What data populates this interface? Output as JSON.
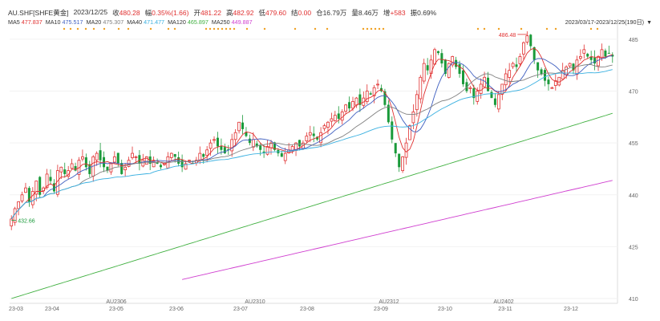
{
  "header": {
    "symbol": "AU.SHF[SHFE黄金]",
    "date": "2023/12/25",
    "close_label": "收",
    "close": "480.28",
    "change_label": "幅",
    "change": "0.35%(1.66)",
    "open_label": "开",
    "open": "481.22",
    "high_label": "高",
    "high": "482.92",
    "low_label": "低",
    "low": "479.60",
    "settle_label": "结",
    "settle": "0.00",
    "oi_label": "仓",
    "oi": "16.79万",
    "vol_label": "量",
    "vol": "8.46万",
    "oichg_label": "增",
    "oichg": "+583",
    "amp_label": "振",
    "amp": "0.69%"
  },
  "ma_legend": [
    {
      "label": "MA5",
      "value": "477.837",
      "color": "#e03030"
    },
    {
      "label": "MA10",
      "value": "475.517",
      "color": "#4060c0"
    },
    {
      "label": "MA20",
      "value": "475.307",
      "color": "#808080"
    },
    {
      "label": "MA40",
      "value": "471.477",
      "color": "#3ab0e0"
    },
    {
      "label": "MA120",
      "value": "465.897",
      "color": "#40b040"
    },
    {
      "label": "MA250",
      "value": "449.887",
      "color": "#d040d0"
    }
  ],
  "date_range": "2023/03/17-2023/12/25(190日)",
  "colors": {
    "up": "#e03030",
    "down": "#1a9a3a",
    "dot": "#f0a020"
  },
  "chart_data": {
    "type": "candlestick",
    "ylim": [
      410,
      488
    ],
    "y_ticks": [
      "485",
      "470",
      "455",
      "440",
      "425",
      "410"
    ],
    "x_ticks": [
      "23-03",
      "23-04",
      "AU2306",
      "23-05",
      "23-06",
      "23-07",
      "AU2310",
      "23-08",
      "23-09",
      "AU2312",
      "23-10",
      "23-11",
      "AU2402",
      "23-12"
    ],
    "max_label": "486.48",
    "min_label": "432.66",
    "close_series": [
      433,
      436,
      438,
      440,
      442,
      438,
      441,
      444,
      440,
      442,
      446,
      444,
      441,
      447,
      448,
      446,
      447,
      449,
      447,
      450,
      451,
      448,
      446,
      451,
      452,
      450,
      448,
      447,
      449,
      451,
      449,
      446,
      448,
      450,
      452,
      451,
      449,
      450,
      451,
      449,
      450,
      449,
      448,
      449,
      451,
      452,
      451,
      449,
      448,
      449,
      450,
      449,
      450,
      452,
      451,
      453,
      455,
      456,
      454,
      453,
      452,
      453,
      456,
      458,
      461,
      459,
      457,
      455,
      456,
      454,
      453,
      452,
      454,
      455,
      453,
      452,
      451,
      452,
      453,
      454,
      455,
      454,
      455,
      457,
      458,
      457,
      456,
      458,
      460,
      461,
      462,
      463,
      462,
      464,
      466,
      465,
      467,
      468,
      466,
      468,
      470,
      469,
      471,
      472,
      470,
      466,
      461,
      456,
      452,
      448,
      451,
      455,
      460,
      464,
      469,
      474,
      478,
      476,
      479,
      482,
      481,
      478,
      475,
      478,
      480,
      477,
      475,
      472,
      470,
      471,
      468,
      470,
      472,
      474,
      470,
      468,
      466,
      469,
      472,
      475,
      476,
      478,
      477,
      480,
      484,
      486,
      483,
      479,
      476,
      475,
      473,
      472,
      471,
      473,
      474,
      476,
      477,
      478,
      476,
      479,
      480,
      482,
      480,
      479,
      478,
      480,
      482,
      480,
      481,
      480
    ],
    "series": [
      {
        "name": "MA5",
        "color": "#e03030"
      },
      {
        "name": "MA10",
        "color": "#4060c0"
      },
      {
        "name": "MA20",
        "color": "#808080"
      },
      {
        "name": "MA40",
        "color": "#3ab0e0"
      },
      {
        "name": "MA120",
        "color": "#40b040"
      },
      {
        "name": "MA250",
        "color": "#d040d0"
      }
    ]
  }
}
